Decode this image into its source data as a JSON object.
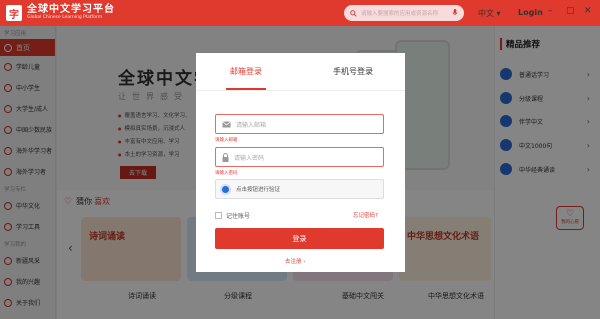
{
  "header": {
    "logo_glyph": "字",
    "brand_cn": "全球中文学习平台",
    "brand_en": "Global Chinese Learning Platform",
    "search_placeholder": "请输入要搜索的应用或资源名称",
    "lang": "中文",
    "login": "Login",
    "win_min": "–",
    "win_max": "▢",
    "win_close": "✕"
  },
  "sidebar": {
    "section1": "学习应用",
    "home": "首页",
    "items1": [
      "学龄儿童",
      "中小学生",
      "大学生/成人",
      "中国少数民族",
      "海外华学习者",
      "海外学习者"
    ],
    "section2": "学习专栏",
    "items2": [
      "中华文化",
      "学习工具"
    ],
    "section3": "学习我的",
    "items3": [
      "新疆风采",
      "我的兴趣",
      "关于我们"
    ]
  },
  "banner": {
    "title": "全球中文学",
    "subtitle": "让世界感受",
    "bullets": [
      "覆盖语言学习、文化学习、",
      "模拟真实场景，沉浸式人",
      "丰富有中文应用、学习",
      "本土的学习资源，学习",
      "丰富的学习资源，学习"
    ],
    "download": "去下载"
  },
  "guess": {
    "prefix": "猜你",
    "highlight": "喜欢"
  },
  "cards": [
    {
      "title": "诗词诵读",
      "caption": "诗词诵读",
      "color": "#fde7d4"
    },
    {
      "title": "",
      "caption": "分级课程",
      "color": "#d8eef9"
    },
    {
      "title": "",
      "caption": "基础中文闯关",
      "color": "#f7e2ec"
    },
    {
      "title": "中华思想文化术语",
      "caption": "中华思想文化术语",
      "color": "#fff1e0"
    }
  ],
  "right_panel": {
    "title": "精品推荐",
    "items": [
      "普通话学习",
      "分级课程",
      "伴学中文",
      "中文1000句",
      "中华经典诵读"
    ],
    "wishlist": "我的心愿"
  },
  "modal": {
    "tab_email": "邮箱登录",
    "tab_phone": "手机号登录",
    "email_placeholder": "请输入邮箱",
    "email_error": "请输入邮箱",
    "password_placeholder": "请输入密码",
    "password_error": "请输入密码",
    "captcha_text": "点击按钮进行验证",
    "remember": "记住账号",
    "forgot": "忘记密码?",
    "login_button": "登录",
    "register": "去注册"
  },
  "colors": {
    "brand_red": "#e03a2f",
    "captcha_blue": "#2b6cd4"
  },
  "icons": [
    "logo-icon",
    "search-icon",
    "mic-icon",
    "mail-icon",
    "lock-icon",
    "captcha-icon",
    "heart-icon"
  ]
}
